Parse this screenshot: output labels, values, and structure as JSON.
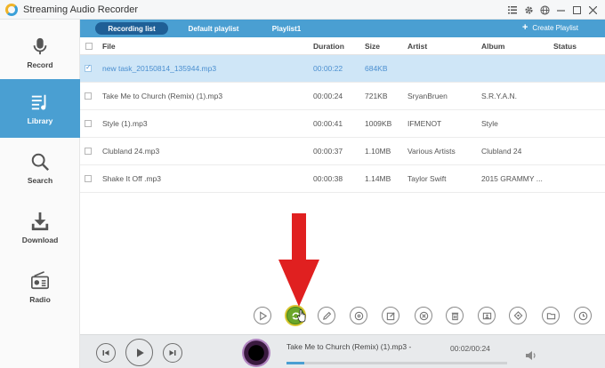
{
  "window": {
    "title": "Streaming Audio Recorder"
  },
  "sidebar": {
    "items": [
      {
        "label": "Record",
        "icon": "microphone-icon",
        "active": false
      },
      {
        "label": "Library",
        "icon": "library-icon",
        "active": true
      },
      {
        "label": "Search",
        "icon": "search-icon",
        "active": false
      },
      {
        "label": "Download",
        "icon": "download-icon",
        "active": false
      },
      {
        "label": "Radio",
        "icon": "radio-icon",
        "active": false
      }
    ]
  },
  "tabs": {
    "items": [
      {
        "label": "Recording list",
        "active": true
      },
      {
        "label": "Default playlist",
        "active": false
      },
      {
        "label": "Playlist1",
        "active": false
      }
    ],
    "create_label": "Create Playlist"
  },
  "table": {
    "headers": {
      "file": "File",
      "duration": "Duration",
      "size": "Size",
      "artist": "Artist",
      "album": "Album",
      "status": "Status"
    },
    "rows": [
      {
        "file": "new task_20150814_135944.mp3",
        "duration": "00:00:22",
        "size": "684KB",
        "artist": "",
        "album": "",
        "status": "",
        "selected": true
      },
      {
        "file": "Take Me to Church (Remix) (1).mp3",
        "duration": "00:00:24",
        "size": "721KB",
        "artist": "SryanBruen",
        "album": "S.R.Y.A.N.",
        "status": "",
        "selected": false
      },
      {
        "file": "Style (1).mp3",
        "duration": "00:00:41",
        "size": "1009KB",
        "artist": "IFMENOT",
        "album": "Style",
        "status": "",
        "selected": false
      },
      {
        "file": "Clubland 24.mp3",
        "duration": "00:00:37",
        "size": "1.10MB",
        "artist": "Various Artists",
        "album": "Clubland 24",
        "status": "",
        "selected": false
      },
      {
        "file": "Shake It Off .mp3",
        "duration": "00:00:38",
        "size": "1.14MB",
        "artist": "Taylor Swift",
        "album": "2015 GRAMMY ...",
        "status": "",
        "selected": false
      }
    ]
  },
  "toolbar": {
    "buttons": [
      {
        "icon": "play-icon",
        "highlighted": false
      },
      {
        "icon": "convert-icon",
        "highlighted": true
      },
      {
        "icon": "edit-icon",
        "highlighted": false
      },
      {
        "icon": "cd-burn-icon",
        "highlighted": false
      },
      {
        "icon": "edit-tags-icon",
        "highlighted": false
      },
      {
        "icon": "remove-icon",
        "highlighted": false
      },
      {
        "icon": "delete-icon",
        "highlighted": false
      },
      {
        "icon": "ringtone-icon",
        "highlighted": false
      },
      {
        "icon": "identify-icon",
        "highlighted": false
      },
      {
        "icon": "folder-icon",
        "highlighted": false
      },
      {
        "icon": "schedule-icon",
        "highlighted": false
      }
    ]
  },
  "player": {
    "now_playing": "Take Me to Church (Remix) (1).mp3 -",
    "time": "00:02/00:24",
    "progress_fraction": 0.08
  },
  "colors": {
    "accent": "#4a9fd2",
    "tab_active": "#1f5f96",
    "selected_row": "#cfe6f7",
    "selected_text": "#4b8fd0",
    "annotation_arrow": "#e02020",
    "convert_button": "#6aa62a"
  }
}
